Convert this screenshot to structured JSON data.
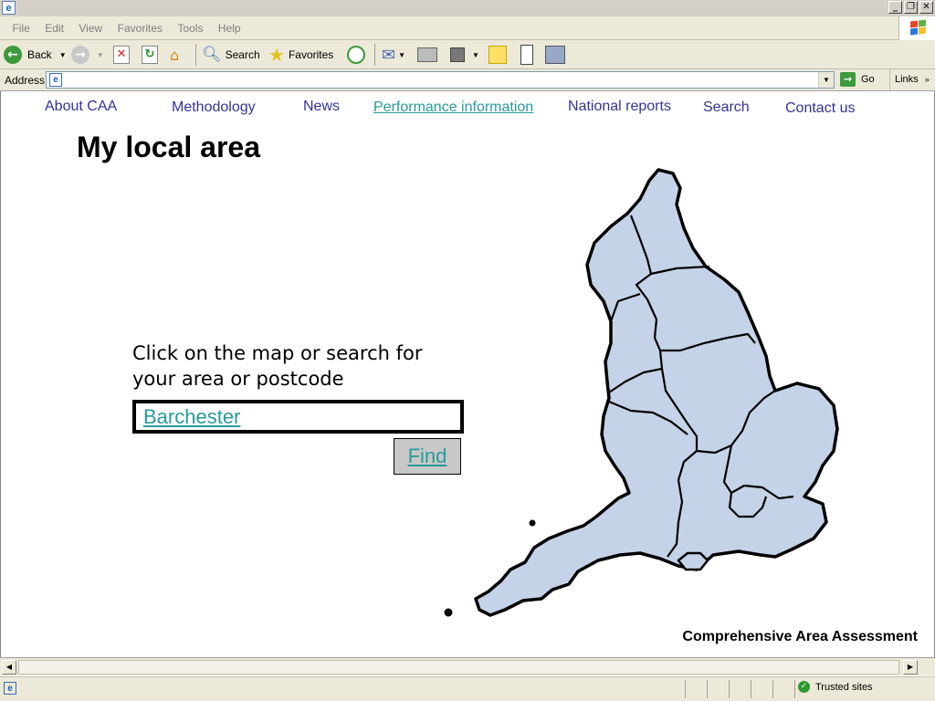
{
  "browser": {
    "menu": [
      "File",
      "Edit",
      "View",
      "Favorites",
      "Tools",
      "Help"
    ],
    "toolbar": {
      "back_label": "Back",
      "search_label": "Search",
      "favorites_label": "Favorites"
    },
    "address": {
      "label": "Address",
      "value": "",
      "go_label": "Go",
      "links_label": "Links"
    },
    "status": {
      "zone_label": "Trusted sites"
    }
  },
  "site": {
    "nav": [
      {
        "label": "About CAA",
        "active": false
      },
      {
        "label": "Methodology",
        "active": false
      },
      {
        "label": "News",
        "active": false
      },
      {
        "label": "Performance information",
        "active": true
      },
      {
        "label": "National reports",
        "active": false
      },
      {
        "label": "Search",
        "active": false
      },
      {
        "label": "Contact us",
        "active": false
      }
    ],
    "page_title": "My local area",
    "prompt": "Click on the map or search for your area or postcode",
    "search": {
      "value": "Barchester"
    },
    "find_label": "Find",
    "footer": "Comprehensive Area Assessment"
  },
  "colors": {
    "nav_link": "#333399",
    "active_link": "#2a9a9a",
    "map_fill": "#c5d3e8",
    "map_stroke": "#000000",
    "button_bg": "#c8c8c8"
  },
  "icons": {
    "back": "back-arrow-icon",
    "forward": "forward-arrow-icon",
    "stop": "stop-icon",
    "refresh": "refresh-icon",
    "home": "home-icon",
    "search": "search-magnifier-icon",
    "favorites": "favorites-star-icon",
    "history": "history-icon",
    "mail": "mail-icon",
    "print": "print-icon"
  }
}
